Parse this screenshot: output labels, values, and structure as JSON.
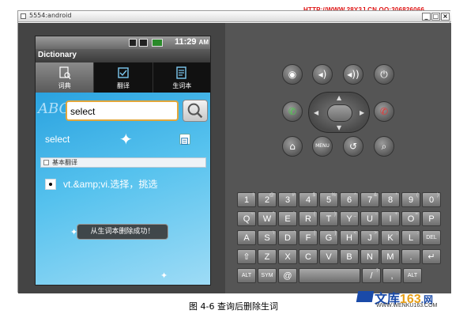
{
  "watermark_top": "HTTP://WWW.28Y3J.CN QQ:306826066",
  "window": {
    "title": "5554:android",
    "buttons": [
      "_",
      "□",
      "×"
    ]
  },
  "status_bar": {
    "time": "11:29",
    "ampm": "AM"
  },
  "app": {
    "title": "Dictionary",
    "tabs": [
      {
        "label": "词典",
        "icon": "dictionary-icon"
      },
      {
        "label": "翻译",
        "icon": "translate-icon"
      },
      {
        "label": "生词本",
        "icon": "wordbook-icon"
      }
    ],
    "abc_logo": "ABC",
    "search": {
      "value": "select"
    },
    "word": "select",
    "section_title": "基本翻译",
    "definition": "vt.&amp;vi.选择，挑选",
    "toast": "从生词本删除成功！"
  },
  "controls": {
    "menu_label": "MENU"
  },
  "keyboard": {
    "row1": [
      {
        "k": "1",
        "a": "!"
      },
      {
        "k": "2",
        "a": "@"
      },
      {
        "k": "3",
        "a": "#"
      },
      {
        "k": "4",
        "a": "$"
      },
      {
        "k": "5",
        "a": "%"
      },
      {
        "k": "6",
        "a": "^"
      },
      {
        "k": "7",
        "a": "&"
      },
      {
        "k": "8",
        "a": "*"
      },
      {
        "k": "9",
        "a": "("
      },
      {
        "k": "0",
        "a": ")"
      }
    ],
    "row2": [
      {
        "k": "Q",
        "a": "~"
      },
      {
        "k": "W",
        "a": "\""
      },
      {
        "k": "E",
        "a": "`"
      },
      {
        "k": "R",
        "a": "{"
      },
      {
        "k": "T",
        "a": "}"
      },
      {
        "k": "Y",
        "a": "_"
      },
      {
        "k": "U",
        "a": "-"
      },
      {
        "k": "I",
        "a": "+"
      },
      {
        "k": "O",
        "a": "="
      },
      {
        "k": "P",
        "a": ""
      }
    ],
    "row3": [
      {
        "k": "A",
        "a": ""
      },
      {
        "k": "S",
        "a": "\\"
      },
      {
        "k": "D",
        "a": "'"
      },
      {
        "k": "F",
        "a": "["
      },
      {
        "k": "G",
        "a": "]"
      },
      {
        "k": "H",
        "a": "<"
      },
      {
        "k": "J",
        "a": ">"
      },
      {
        "k": "K",
        "a": ";"
      },
      {
        "k": "L",
        "a": ":"
      },
      {
        "k": "DEL",
        "a": ""
      }
    ],
    "row4": [
      {
        "k": "⇧",
        "a": ""
      },
      {
        "k": "Z",
        "a": ""
      },
      {
        "k": "X",
        "a": ""
      },
      {
        "k": "C",
        "a": ""
      },
      {
        "k": "V",
        "a": ""
      },
      {
        "k": "B",
        "a": ""
      },
      {
        "k": "N",
        "a": ""
      },
      {
        "k": "M",
        "a": ""
      },
      {
        "k": ".",
        "a": ""
      },
      {
        "k": "↵",
        "a": ""
      }
    ],
    "row5": [
      {
        "k": "ALT",
        "a": ""
      },
      {
        "k": "SYM",
        "a": ""
      },
      {
        "k": "@",
        "a": ""
      },
      {
        "k": "",
        "a": ""
      },
      {
        "k": "/",
        "a": "?"
      },
      {
        "k": ",",
        "a": ""
      },
      {
        "k": "ALT",
        "a": ""
      }
    ]
  },
  "caption": "图 4-6  查询后删除生词",
  "watermark_logo": {
    "line1_a": "文库",
    "line1_b": "163",
    "line1_c": ".网",
    "line2": "WWW.WENKU163.COM"
  }
}
